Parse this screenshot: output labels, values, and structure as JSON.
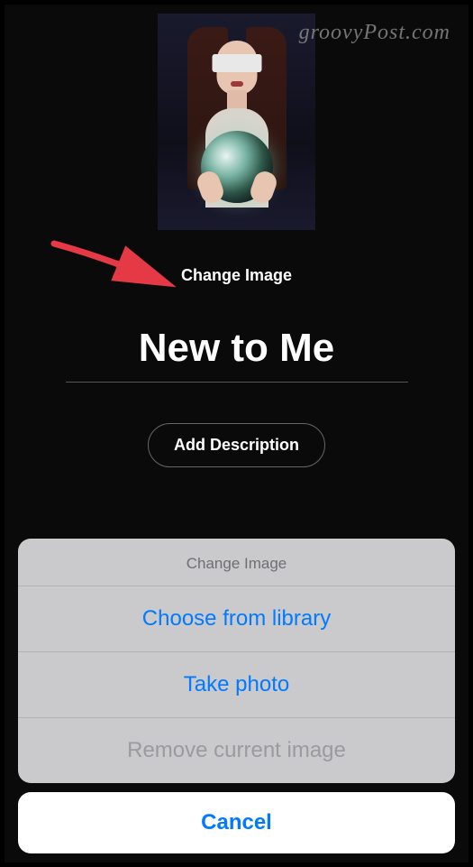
{
  "watermark": "groovyPost.com",
  "change_image_label": "Change Image",
  "playlist_title": "New to Me",
  "add_description_label": "Add Description",
  "sheet": {
    "title": "Change Image",
    "choose_library": "Choose from library",
    "take_photo": "Take photo",
    "remove_image": "Remove current image",
    "cancel": "Cancel"
  }
}
